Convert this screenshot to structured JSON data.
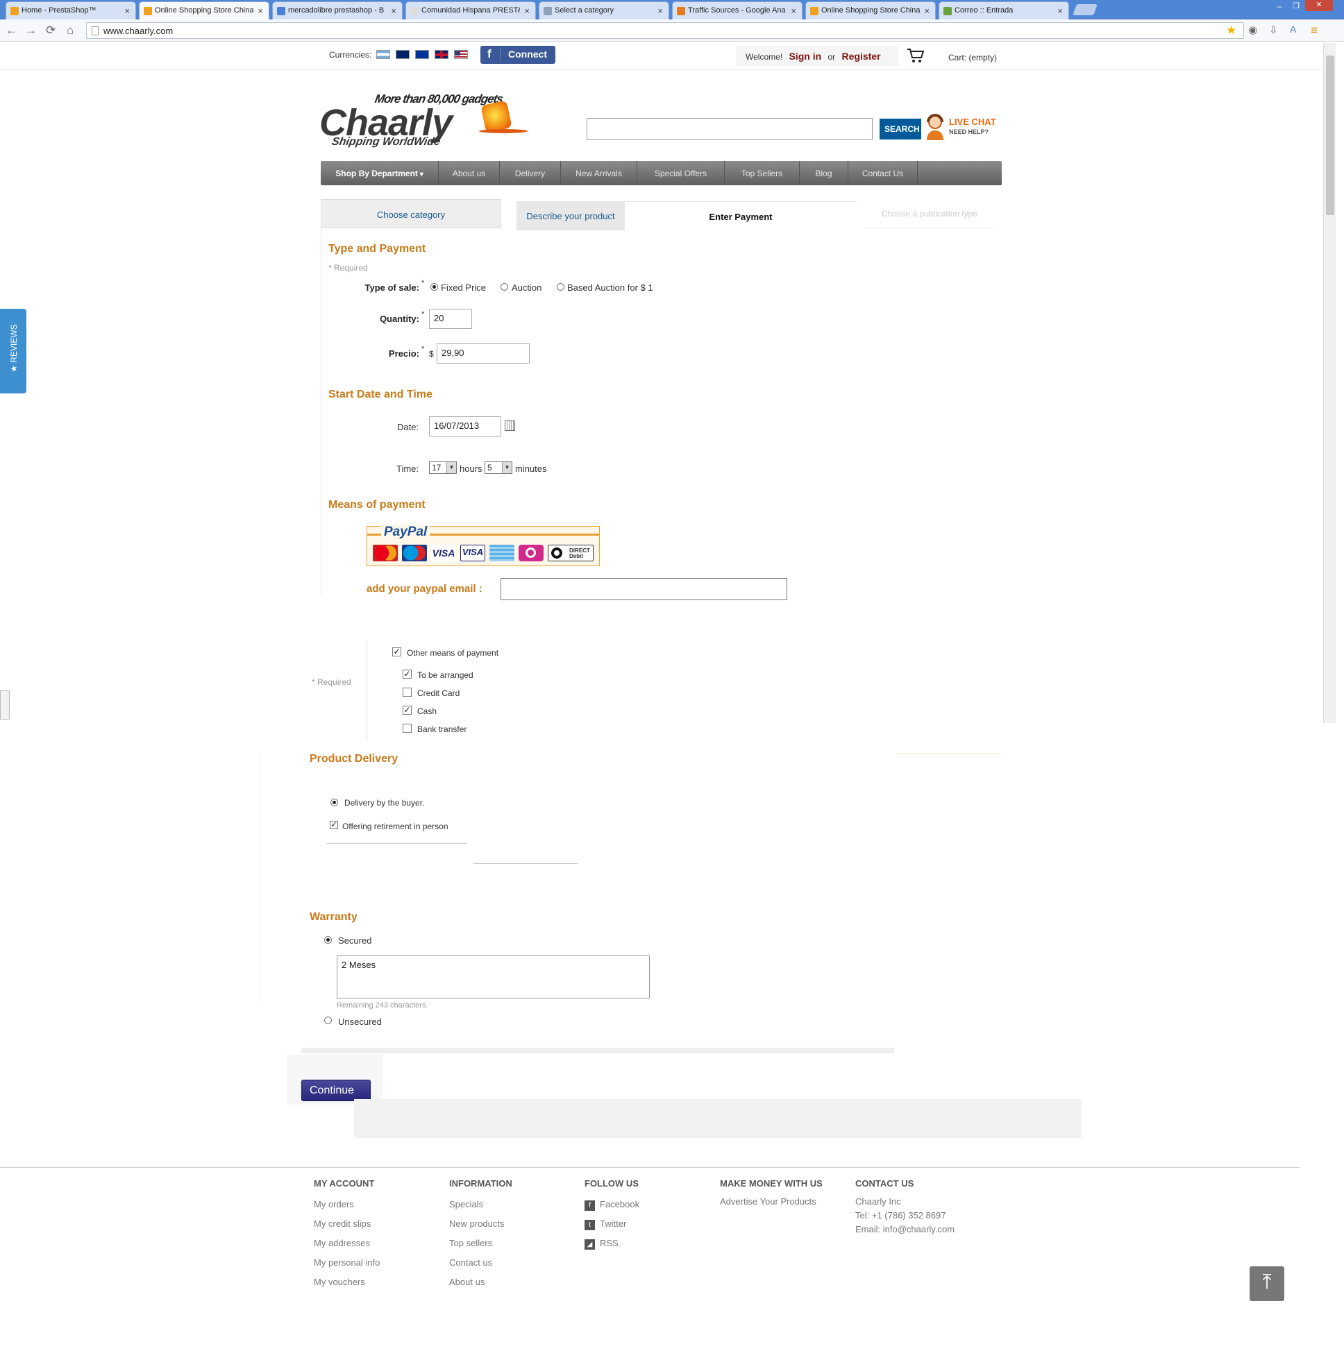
{
  "browser": {
    "tabs": [
      {
        "title": "Home - PrestaShop™",
        "active": false,
        "favicon_color": "#f0a020"
      },
      {
        "title": "Online Shopping Store China",
        "active": true,
        "favicon_color": "#f0a020"
      },
      {
        "title": "mercadolibre prestashop - B",
        "active": false,
        "favicon_color": "#4a7fd8"
      },
      {
        "title": "Comunidad Hispana PRESTA",
        "active": false,
        "favicon_color": "#dddddd"
      },
      {
        "title": "Select a category",
        "active": false,
        "favicon_color": "#8fa0b8"
      },
      {
        "title": "Traffic Sources - Google Ana",
        "active": false,
        "favicon_color": "#e67a1e"
      },
      {
        "title": "Online Shopping Store China",
        "active": false,
        "favicon_color": "#f0a020"
      },
      {
        "title": "Correo :: Entrada",
        "active": false,
        "favicon_color": "#6aa040"
      }
    ],
    "url": "www.chaarly.com"
  },
  "topbar": {
    "currencies_label": "Currencies:",
    "currency_flags": [
      "argentina-flag",
      "australia-flag",
      "eu-flag",
      "uk-flag",
      "us-flag"
    ],
    "connect_label": "Connect",
    "welcome": "Welcome!",
    "sign_in": "Sign in",
    "or": "or",
    "register": "Register",
    "cart": "Cart: (empty)"
  },
  "header": {
    "logo_tagline": "More than 80,000 gadgets",
    "logo_name": "Chaarly",
    "logo_sub": "Shipping WorldWide",
    "search_value": "",
    "search_button": "SEARCH",
    "live_chat": "LIVE CHAT",
    "need_help": "NEED HELP?"
  },
  "menu": [
    "Shop By Department",
    "About us",
    "Delivery",
    "New Arrivals",
    "Special Offers",
    "Top Sellers",
    "Blog",
    "Contact Us"
  ],
  "wizard": {
    "steps": [
      "Choose category",
      "Describe your product",
      "Enter Payment",
      "Choose a publication type"
    ]
  },
  "form": {
    "type_payment": {
      "heading": "Type and Payment",
      "required": "* Required",
      "type_label": "Type of sale:",
      "options": [
        "Fixed Price",
        "Auction",
        "Based Auction for $ 1"
      ],
      "selected": 0,
      "quantity_label": "Quantity:",
      "quantity_value": "20",
      "price_label": "Precio:",
      "currency": "$",
      "price_value": "29,90"
    },
    "start": {
      "heading": "Start Date and Time",
      "date_label": "Date:",
      "date_value": "16/07/2013",
      "time_label": "Time:",
      "hours_value": "17",
      "hours_label": "hours",
      "minutes_value": "5",
      "minutes_label": "minutes"
    },
    "means": {
      "heading": "Means of payment",
      "paypal_title": "PayPal",
      "cards": [
        "MasterCard",
        "Maestro",
        "VISA",
        "VISA Electron",
        "AmEx",
        "Solo",
        "Direct Debit"
      ],
      "paypal_email_label": "add your paypal email :",
      "paypal_email_value": "",
      "required": "* Required",
      "other_label": "Other means of payment",
      "other_checked": true,
      "items": [
        {
          "label": "To be arranged",
          "checked": true
        },
        {
          "label": "Credit Card",
          "checked": false
        },
        {
          "label": "Cash",
          "checked": true
        },
        {
          "label": "Bank transfer",
          "checked": false
        }
      ]
    },
    "delivery": {
      "heading": "Product Delivery",
      "buyer_label": "Delivery by the buyer.",
      "retire_label": "Offering retirement in person"
    },
    "warranty": {
      "heading": "Warranty",
      "secured_label": "Secured",
      "text_value": "2 Meses",
      "remaining": "Remaining 243 characters.",
      "unsecured_label": "Unsecured"
    },
    "continue_label": "Continue"
  },
  "side_tab": "★ REVIEWS",
  "footer": {
    "my_account": {
      "title": "MY ACCOUNT",
      "links": [
        "My orders",
        "My credit slips",
        "My addresses",
        "My personal info",
        "My vouchers"
      ]
    },
    "information": {
      "title": "INFORMATION",
      "links": [
        "Specials",
        "New products",
        "Top sellers",
        "Contact us",
        "About us"
      ]
    },
    "follow": {
      "title": "FOLLOW US",
      "links": [
        "Facebook",
        "Twitter",
        "RSS"
      ]
    },
    "money": {
      "title": "MAKE MONEY WITH US",
      "links": [
        "Advertise Your Products"
      ]
    },
    "contact": {
      "title": "CONTACT US",
      "lines": [
        "Chaarly Inc",
        "Tel: +1 (786) 352 8697",
        "Email: info@chaarly.com"
      ]
    }
  }
}
